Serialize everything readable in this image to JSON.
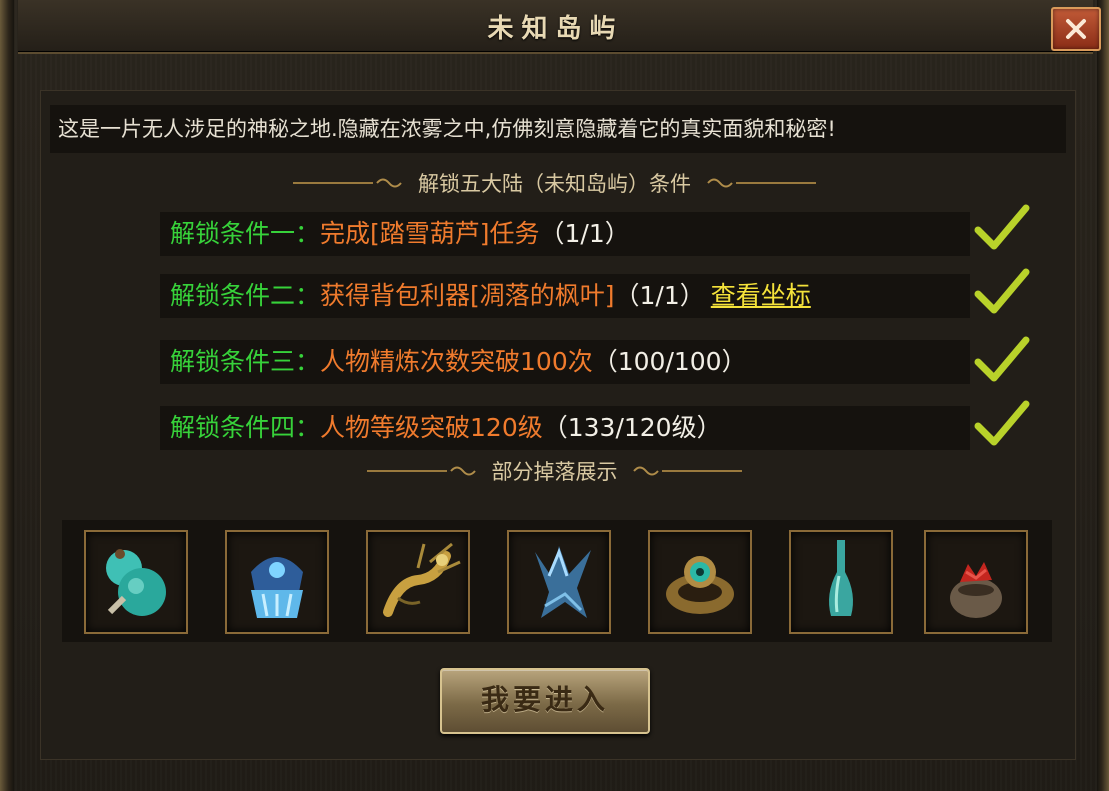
{
  "window": {
    "title": "未知岛屿"
  },
  "intro": "这是一片无人涉足的神秘之地.隐藏在浓雾之中,仿佛刻意隐藏着它的真实面貌和秘密!",
  "unlock": {
    "heading": "解锁五大陆（未知岛屿）条件",
    "conditions": [
      {
        "label": "解锁条件一：",
        "task": "完成[踏雪葫芦]任务",
        "progress": "（1/1）",
        "link": "",
        "completed": true
      },
      {
        "label": "解锁条件二：",
        "task": "获得背包利器[凋落的枫叶]",
        "progress": "（1/1）",
        "link": "查看坐标",
        "completed": true
      },
      {
        "label": "解锁条件三：",
        "task": "人物精炼次数突破100次",
        "progress": "（100/100）",
        "link": "",
        "completed": true
      },
      {
        "label": "解锁条件四：",
        "task": "人物等级突破120级",
        "progress": "（133/120级）",
        "link": "",
        "completed": true
      }
    ]
  },
  "drops": {
    "heading": "部分掉落展示",
    "items": [
      {
        "icon": "gourd-icon"
      },
      {
        "icon": "crystal-helmet-icon"
      },
      {
        "icon": "golden-dragon-icon"
      },
      {
        "icon": "ice-claw-icon"
      },
      {
        "icon": "jade-ring-icon"
      },
      {
        "icon": "jade-vase-icon"
      },
      {
        "icon": "flower-pot-icon"
      }
    ]
  },
  "enter_button": "我要进入",
  "colors": {
    "condition_label": "#37d23a",
    "condition_task": "#f07b2d",
    "link": "#f4e23a",
    "check": "#b9d22a"
  }
}
